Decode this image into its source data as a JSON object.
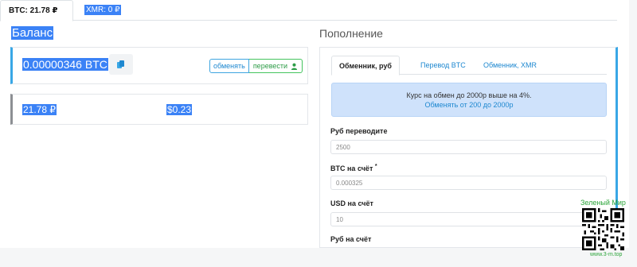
{
  "top_tabs": [
    {
      "label": "BTC: 21.78 ₽",
      "active": true
    },
    {
      "label": "XMR: 0 ₽",
      "active": false
    }
  ],
  "balance": {
    "title": "Баланс",
    "btc_value": "0.00000346 BTC",
    "exchange_label": "обменять",
    "transfer_label": "перевести",
    "rub_value": "21.78 ₽",
    "usd_value": "$0.23"
  },
  "replenish": {
    "title": "Пополнение",
    "tabs": [
      {
        "label": "Обменник, руб",
        "active": true
      },
      {
        "label": "Перевод BTC",
        "active": false
      },
      {
        "label": "Обменник, XMR",
        "active": false
      }
    ],
    "alert_text": "Курс на обмен до 2000р выше на 4%.",
    "alert_link": "Обменять от 200 до 2000р",
    "fields": [
      {
        "label": "Руб переводите",
        "value": "2500"
      },
      {
        "label": "BTC на счёт",
        "required_mark": "*",
        "value": "0.000325"
      },
      {
        "label": "USD на счёт",
        "value": "10"
      },
      {
        "label": "Руб на счёт",
        "value": ""
      }
    ]
  },
  "watermark": {
    "title": "Зеленый Мир",
    "url": "www.3-m.top"
  },
  "colors": {
    "accent_blue": "#39a7e6",
    "link_blue": "#1e88d0",
    "green": "#44c45e",
    "alert_bg": "#cfe2fb",
    "selection": "#3b82f6"
  }
}
